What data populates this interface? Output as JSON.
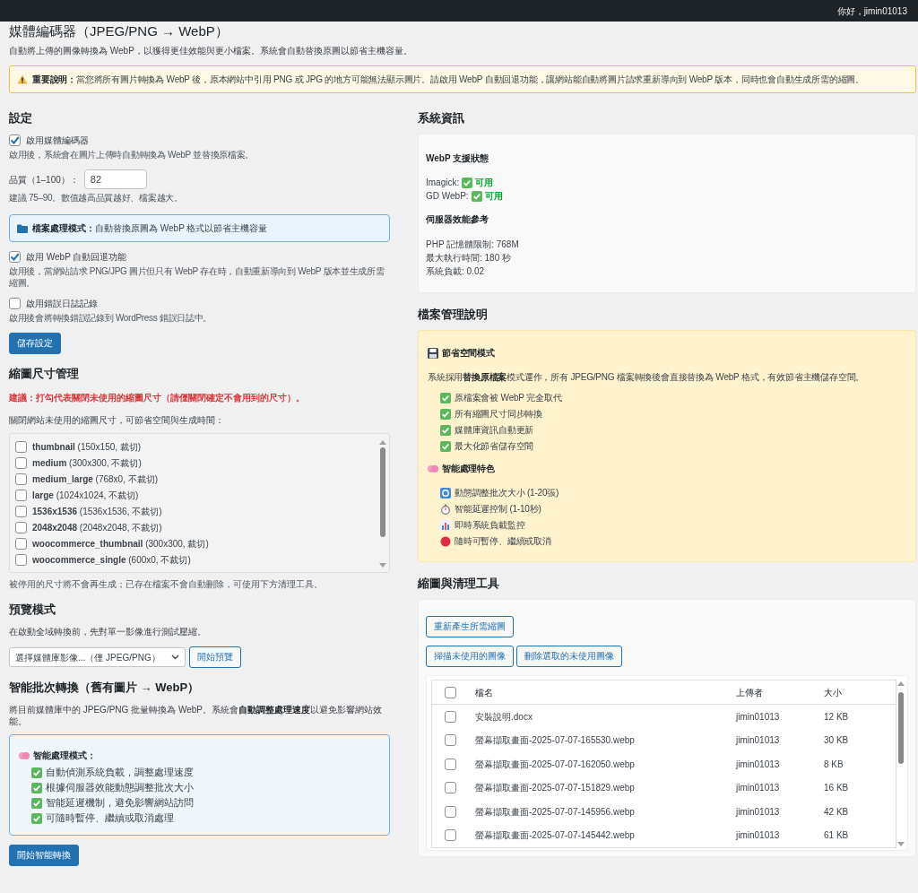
{
  "admin_bar": {
    "greeting": "你好，jimin01013"
  },
  "page": {
    "title": "媒體編碼器（JPEG/PNG → WebP）",
    "intro": "自動將上傳的圖像轉換為 WebP，以獲得更佳效能與更小檔案。系統會自動替換原圖以節省主機容量。",
    "notice": "**重要說明：**當您將所有圖片轉換為 WebP 後，原本網站中引用 PNG 或 JPG 的地方可能無法顯示圖片。請啟用 WebP 自動回退功能，讓網站能自動將圖片請求重新導向到 WebP 版本，同時也會自動生成所需的縮圖。"
  },
  "settings": {
    "heading": "設定",
    "options": [
      {
        "kind": "checkbox",
        "label": "啟用媒體編碼器",
        "checked": true,
        "help": "啟用後，系統會在圖片上傳時自動轉換為 WebP 並替換原檔案。"
      },
      {
        "kind": "number",
        "label": "品質（1–100）：",
        "value": "82",
        "help": "建議 75–90。數值越高品質越好、檔案越大。"
      },
      {
        "kind": "info",
        "text": "**檔案處理模式：**自動替換原圖為 WebP 格式以節省主機容量"
      },
      {
        "kind": "checkbox",
        "label": "啟用 WebP 自動回退功能",
        "checked": true,
        "help": "啟用後，當網站請求 PNG/JPG 圖片但只有 WebP 存在時，自動重新導向到 WebP 版本並生成所需縮圖。"
      },
      {
        "kind": "checkbox",
        "label": "啟用錯誤日誌記錄",
        "checked": false,
        "help": "啟用後會將轉換錯誤記錄到 WordPress 錯誤日誌中。"
      }
    ],
    "save_button": "儲存設定"
  },
  "sizes": {
    "heading": "縮圖尺寸管理",
    "warning": "建議：打勾代表關閉未使用的縮圖尺寸（請僅關閉確定不會用到的尺寸）。",
    "description": "關閉網站未使用的縮圖尺寸，可節省空間與生成時間：",
    "items": [
      {
        "name": "thumbnail",
        "detail": "(150x150, 裁切)",
        "checked": false
      },
      {
        "name": "medium",
        "detail": "(300x300, 不裁切)",
        "checked": false
      },
      {
        "name": "medium_large",
        "detail": "(768x0, 不裁切)",
        "checked": false
      },
      {
        "name": "large",
        "detail": "(1024x1024, 不裁切)",
        "checked": false
      },
      {
        "name": "1536x1536",
        "detail": "(1536x1536, 不裁切)",
        "checked": false
      },
      {
        "name": "2048x2048",
        "detail": "(2048x2048, 不裁切)",
        "checked": false
      },
      {
        "name": "woocommerce_thumbnail",
        "detail": "(300x300, 裁切)",
        "checked": false
      },
      {
        "name": "woocommerce_single",
        "detail": "(600x0, 不裁切)",
        "checked": false
      }
    ],
    "note": "被停用的尺寸將不會再生成；已存在檔案不會自動刪除，可使用下方清理工具。"
  },
  "preview": {
    "heading": "預覽模式",
    "description": "在啟動全域轉換前，先對單一影像進行測試壓縮。",
    "select": {
      "value": "選擇媒體庫影像...（僅 JPEG/PNG）"
    },
    "button": "開始預覽"
  },
  "batch": {
    "heading": "智能批次轉換（舊有圖片 → WebP）",
    "description": "將目前媒體庫中的 JPEG/PNG 批量轉換為 WebP。系統會**自動調整處理速度**以避免影響網站效能。",
    "box_title": "智能處理模式：",
    "features": [
      "自動偵測系統負載，調整處理速度",
      "根據伺服器效能動態調整批次大小",
      "智能延遲機制，避免影響網站訪問",
      "可隨時暫停、繼續或取消處理"
    ],
    "button": "開始智能轉換"
  },
  "system_info": {
    "heading": "系統資訊",
    "support_title": "WebP 支援狀態",
    "support": [
      {
        "label": "Imagick:",
        "status": "可用"
      },
      {
        "label": "GD WebP:",
        "status": "可用"
      }
    ],
    "perf_title": "伺服器效能參考",
    "perf": [
      "PHP 記憶體限制: 768M",
      "最大執行時間: 180 秒",
      "系統負載: 0.02"
    ]
  },
  "file_management": {
    "heading": "檔案管理說明",
    "mode_title": "節省空間模式",
    "description": "系統採用**替換原檔案**模式運作，所有 JPEG/PNG 檔案轉換後會直接替換為 WebP 格式，有效節省主機儲存空間。",
    "benefits": [
      "原檔案會被 WebP 完全取代",
      "所有縮圖尺寸同步轉換",
      "媒體庫資訊自動更新",
      "最大化節省儲存空間"
    ],
    "smart_title": "智能處理特色",
    "smart_features": [
      {
        "kind": "refresh",
        "text": "動態調整批次大小 (1-20張)"
      },
      {
        "kind": "timer",
        "text": "智能延遲控制 (1-10秒)"
      },
      {
        "kind": "chart",
        "text": "即時系統負載監控"
      },
      {
        "kind": "stop",
        "text": "隨時可暫停、繼續或取消"
      }
    ]
  },
  "cleanup": {
    "heading": "縮圖與清理工具",
    "buttons": [
      [
        "重新產生所需縮圖"
      ],
      [
        "掃描未使用的圖像",
        "刪除選取的未使用圖像"
      ]
    ],
    "table": {
      "columns": [
        "檔名",
        "上傳者",
        "大小"
      ],
      "select_all": {
        "checked": false
      },
      "rows": [
        {
          "name": "安裝說明.docx",
          "uploader": "jimin01013",
          "size": "12 KB",
          "checked": false
        },
        {
          "name": "螢幕擷取畫面-2025-07-07-165530.webp",
          "uploader": "jimin01013",
          "size": "30 KB",
          "checked": false
        },
        {
          "name": "螢幕擷取畫面-2025-07-07-162050.webp",
          "uploader": "jimin01013",
          "size": "8 KB",
          "checked": false
        },
        {
          "name": "螢幕擷取畫面-2025-07-07-151829.webp",
          "uploader": "jimin01013",
          "size": "16 KB",
          "checked": false
        },
        {
          "name": "螢幕擷取畫面-2025-07-07-145956.webp",
          "uploader": "jimin01013",
          "size": "42 KB",
          "checked": false
        },
        {
          "name": "螢幕擷取畫面-2025-07-07-145442.webp",
          "uploader": "jimin01013",
          "size": "61 KB",
          "checked": false
        }
      ]
    }
  }
}
